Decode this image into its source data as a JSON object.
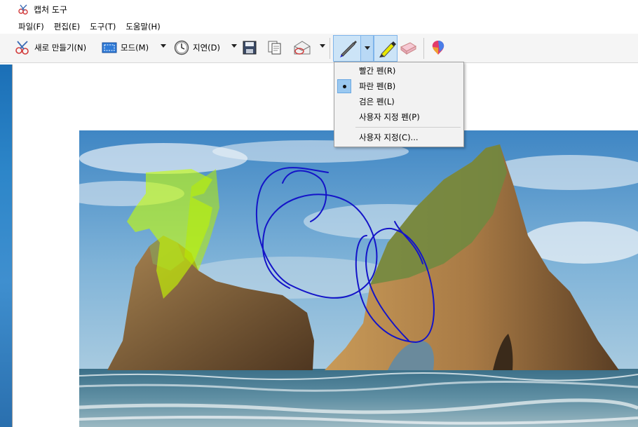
{
  "window": {
    "title": "캡처 도구"
  },
  "menubar": {
    "items": [
      {
        "label": "파일(F)"
      },
      {
        "label": "편집(E)"
      },
      {
        "label": "도구(T)"
      },
      {
        "label": "도움말(H)"
      }
    ]
  },
  "toolbar": {
    "new_label": "새로 만들기(N)",
    "mode_label": "모드(M)",
    "delay_label": "지연(D)",
    "icons": [
      "snip-icon",
      "mode-icon",
      "clock-icon",
      "save-icon",
      "copy-icon",
      "send-mail-icon",
      "pen-icon",
      "highlighter-icon",
      "eraser-icon",
      "paint3d-icon"
    ]
  },
  "pen_menu": {
    "items": [
      {
        "label": "빨간 펜(R)",
        "checked": false
      },
      {
        "label": "파란 펜(B)",
        "checked": true
      },
      {
        "label": "검은 펜(L)",
        "checked": false
      },
      {
        "label": "사용자 지정 펜(P)",
        "checked": false
      }
    ],
    "customize_label": "사용자 지정(C)..."
  },
  "colors": {
    "pen_ink": "#1414c8",
    "highlighter": "#c8ff00",
    "selected_bg": "#cce4f7"
  }
}
